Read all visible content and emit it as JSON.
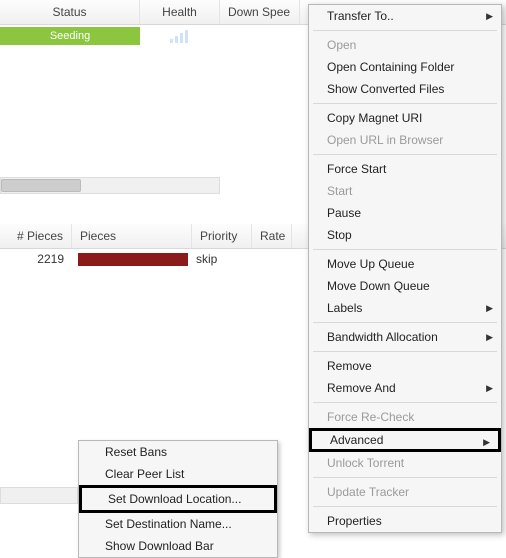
{
  "columns": {
    "status": "Status",
    "health": "Health",
    "downspeed": "Down Spee"
  },
  "torrent": {
    "status": "Seeding"
  },
  "file_columns": {
    "pieces_count": "# Pieces",
    "pieces": "Pieces",
    "priority": "Priority",
    "rate": "Rate"
  },
  "file_row": {
    "pieces_count": "2219",
    "priority": "skip"
  },
  "submenu": {
    "reset_bans": "Reset Bans",
    "clear_peer_list": "Clear Peer List",
    "set_download_location": "Set Download Location...",
    "set_destination_name": "Set Destination Name...",
    "show_download_bar": "Show Download Bar"
  },
  "menu": {
    "transfer_to": "Transfer To..",
    "open": "Open",
    "open_containing_folder": "Open Containing Folder",
    "show_converted_files": "Show Converted Files",
    "copy_magnet_uri": "Copy Magnet URI",
    "open_url_in_browser": "Open URL in Browser",
    "force_start": "Force Start",
    "start": "Start",
    "pause": "Pause",
    "stop": "Stop",
    "move_up_queue": "Move Up Queue",
    "move_down_queue": "Move Down Queue",
    "labels": "Labels",
    "bandwidth_allocation": "Bandwidth Allocation",
    "remove": "Remove",
    "remove_and": "Remove And",
    "force_recheck": "Force Re-Check",
    "advanced": "Advanced",
    "unlock_torrent": "Unlock Torrent",
    "update_tracker": "Update Tracker",
    "properties": "Properties"
  }
}
